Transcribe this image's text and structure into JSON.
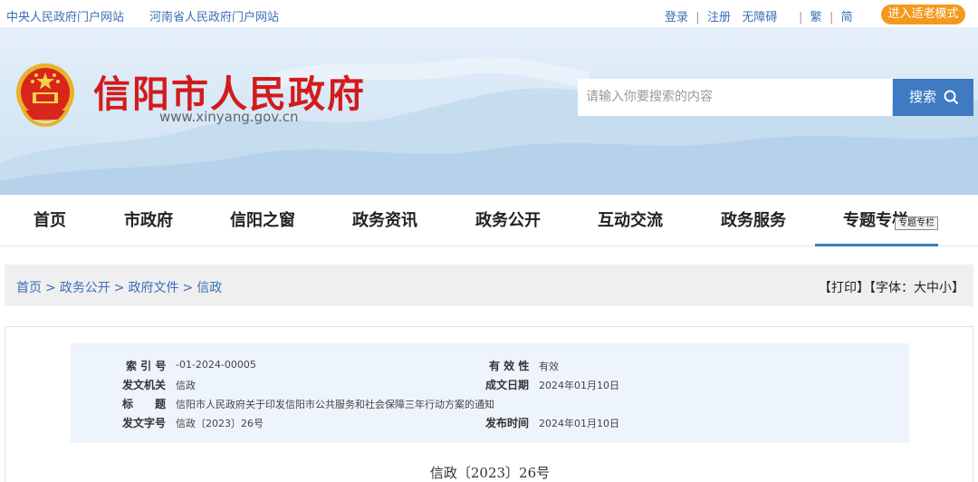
{
  "topbar": {
    "links": [
      "中央人民政府门户网站",
      "河南省人民政府门户网站"
    ],
    "login": "登录",
    "register": "注册",
    "accessibility": "无障碍",
    "traditional": "繁",
    "simplified": "简",
    "elder_mode": "进入适老模式"
  },
  "header": {
    "site_name": "信阳市人民政府",
    "url": "www.xinyang.gov.cn",
    "search_placeholder": "请输入你要搜索的内容",
    "search_label": "搜索"
  },
  "nav": {
    "items": [
      "首页",
      "市政府",
      "信阳之窗",
      "政务资讯",
      "政务公开",
      "互动交流",
      "政务服务",
      "专题专栏"
    ],
    "tooltip": "专题专栏"
  },
  "breadcrumb": {
    "items": [
      "首页",
      "政务公开",
      "政府文件",
      "信政"
    ],
    "print": "【打印】",
    "font_size": "【字体：大中小】"
  },
  "meta": {
    "index_label": "索 引 号",
    "index_value": "-01-2024-00005",
    "validity_label": "有 效 性",
    "validity_value": "有效",
    "issuer_label": "发文机关",
    "issuer_value": "信政",
    "date_label": "成文日期",
    "date_value": "2024年01月10日",
    "title_label": "标　　题",
    "title_value": "信阳市人民政府关于印发信阳市公共服务和社会保障三年行动方案的通知",
    "docno_label": "发文字号",
    "docno_value": "信政〔2023〕26号",
    "pubdate_label": "发布时间",
    "pubdate_value": "2024年01月10日"
  },
  "document": {
    "number": "信政〔2023〕26号"
  },
  "colors": {
    "brand_red": "#d21b1b",
    "link_blue": "#3d6eb5",
    "search_blue": "#3f7ac2",
    "elder_orange": "#f39a1e"
  }
}
